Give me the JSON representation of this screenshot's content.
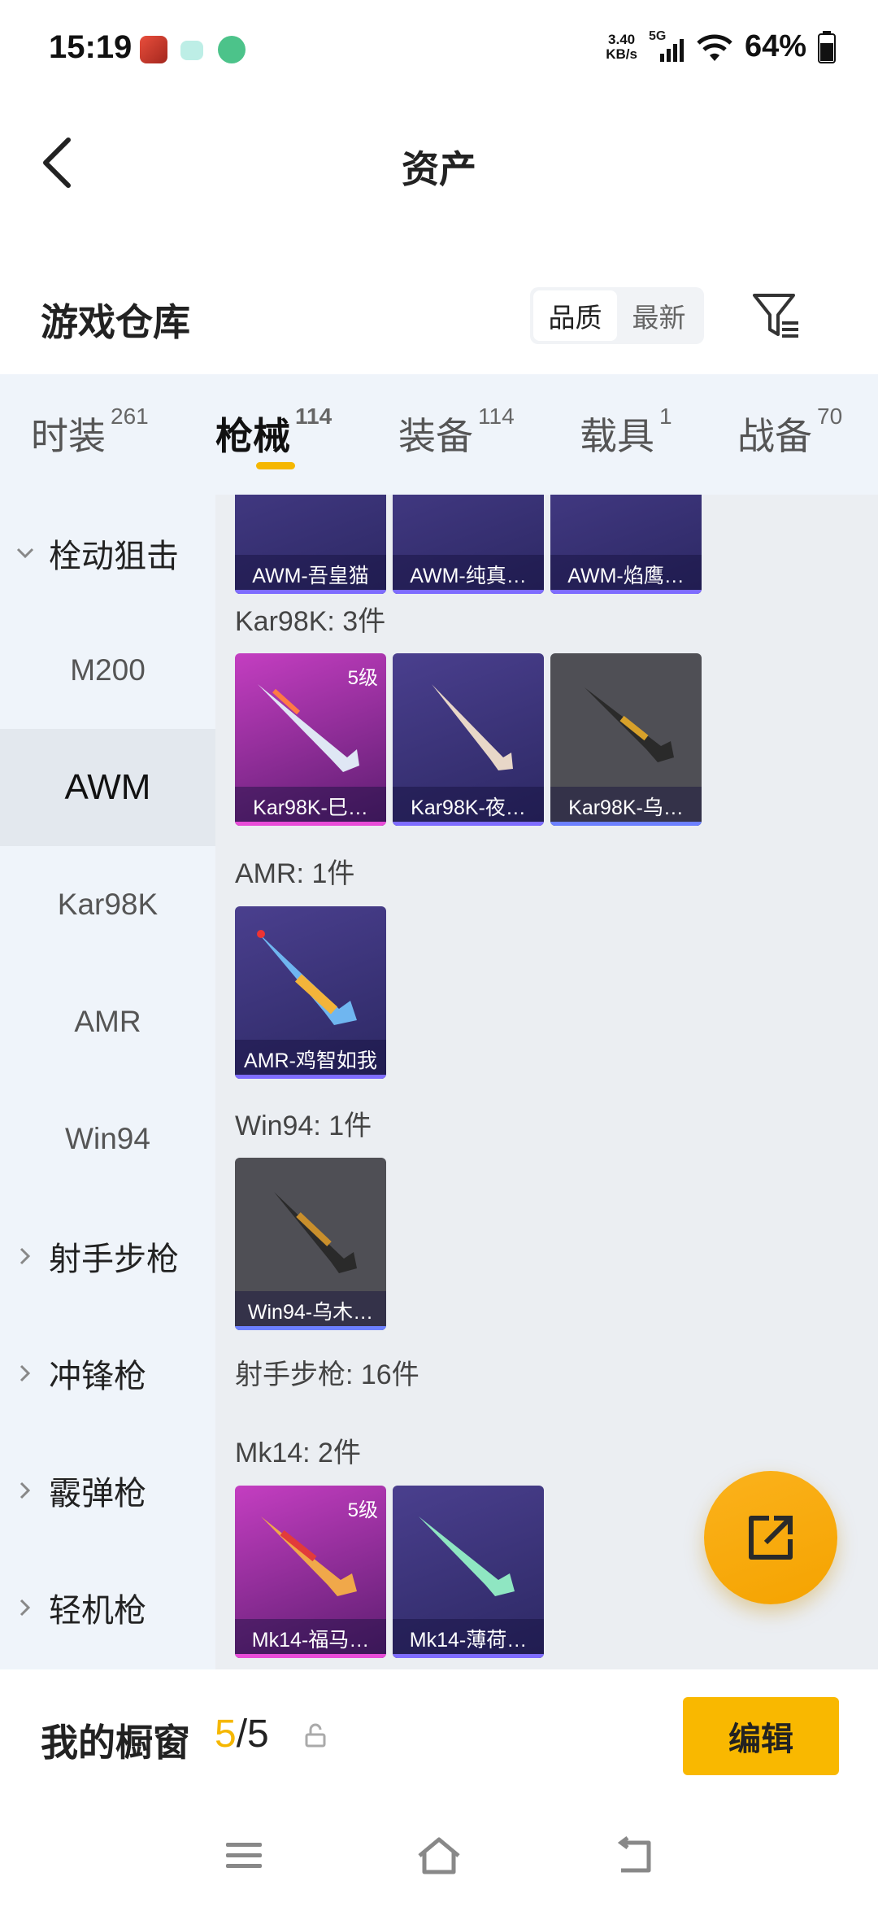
{
  "status": {
    "time": "15:19",
    "net_speed_value": "3.40",
    "net_speed_unit": "KB/s",
    "network": "5G",
    "battery": "64%"
  },
  "header": {
    "title": "资产"
  },
  "section": {
    "title": "游戏仓库",
    "sort_options": [
      "品质",
      "最新"
    ],
    "sort_selected": "品质"
  },
  "tabs": [
    {
      "label": "时装",
      "count": "261"
    },
    {
      "label": "枪械",
      "count": "114"
    },
    {
      "label": "装备",
      "count": "114"
    },
    {
      "label": "载具",
      "count": "1"
    },
    {
      "label": "战备",
      "count": "70"
    }
  ],
  "active_tab": "枪械",
  "sidebar": {
    "group_sniper": "栓动狙击",
    "sub_items": [
      "M200",
      "AWM",
      "Kar98K",
      "AMR",
      "Win94"
    ],
    "selected": "AWM",
    "groups": [
      "射手步枪",
      "冲锋枪",
      "霰弹枪",
      "轻机枪"
    ]
  },
  "content": {
    "awm_cards": [
      "AWM-吾皇猫",
      "AWM-纯真…",
      "AWM-焰鹰…"
    ],
    "kar_label": "Kar98K: 3件",
    "kar_cards": [
      "Kar98K-巳…",
      "Kar98K-夜…",
      "Kar98K-乌…"
    ],
    "kar_level": "5级",
    "amr_label": "AMR: 1件",
    "amr_cards": [
      "AMR-鸡智如我"
    ],
    "win_label": "Win94: 1件",
    "win_cards": [
      "Win94-乌木…"
    ],
    "marksman_label": "射手步枪: 16件",
    "mk14_label": "Mk14: 2件",
    "mk14_cards": [
      "Mk14-福马…",
      "Mk14-薄荷…"
    ],
    "mk14_level": "5级"
  },
  "showcase": {
    "label": "我的橱窗",
    "current": "5",
    "separator": "/",
    "total": "5",
    "edit_label": "编辑"
  },
  "colors": {
    "accent": "#f5b700",
    "card_purple": "#3a3378",
    "card_pink": "#a43aa8",
    "card_gray": "#4f4f55"
  }
}
